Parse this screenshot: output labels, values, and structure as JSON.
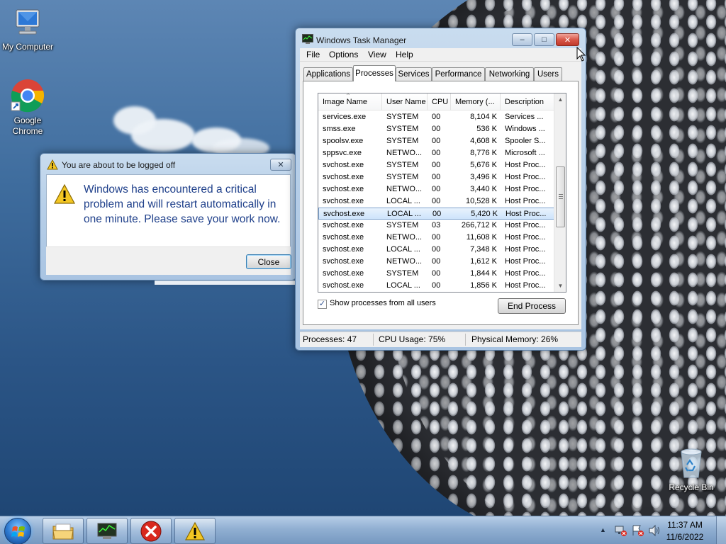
{
  "desktop": {
    "icons": [
      {
        "label": "My Computer",
        "icon": "computer-icon"
      },
      {
        "label": "Google Chrome",
        "icon": "chrome-icon"
      },
      {
        "label": "Recycle Bin",
        "icon": "recycle-bin-icon"
      }
    ]
  },
  "warning_dialog": {
    "title": "You are about to be logged off",
    "message": "Windows has encountered a critical problem and will restart automatically in one minute. Please save your work now.",
    "close_label": "Close",
    "close_glyph": "✕",
    "icon": "warning-icon"
  },
  "taskmgr": {
    "title": "Windows Task Manager",
    "caption": {
      "minimize": "–",
      "maximize": "□",
      "close": "✕"
    },
    "menu": [
      "File",
      "Options",
      "View",
      "Help"
    ],
    "tabs": [
      "Applications",
      "Processes",
      "Services",
      "Performance",
      "Networking",
      "Users"
    ],
    "active_tab": "Processes",
    "columns": [
      "Image Name",
      "User Name",
      "CPU",
      "Memory (...",
      "Description"
    ],
    "rows": [
      [
        "services.exe",
        "SYSTEM",
        "00",
        "8,104 K",
        "Services ..."
      ],
      [
        "smss.exe",
        "SYSTEM",
        "00",
        "536 K",
        "Windows ..."
      ],
      [
        "spoolsv.exe",
        "SYSTEM",
        "00",
        "4,608 K",
        "Spooler S..."
      ],
      [
        "sppsvc.exe",
        "NETWO...",
        "00",
        "8,776 K",
        "Microsoft ..."
      ],
      [
        "svchost.exe",
        "SYSTEM",
        "00",
        "5,676 K",
        "Host Proc..."
      ],
      [
        "svchost.exe",
        "SYSTEM",
        "00",
        "3,496 K",
        "Host Proc..."
      ],
      [
        "svchost.exe",
        "NETWO...",
        "00",
        "3,440 K",
        "Host Proc..."
      ],
      [
        "svchost.exe",
        "LOCAL ...",
        "00",
        "10,528 K",
        "Host Proc..."
      ],
      [
        "svchost.exe",
        "LOCAL ...",
        "00",
        "5,420 K",
        "Host Proc..."
      ],
      [
        "svchost.exe",
        "SYSTEM",
        "03",
        "266,712 K",
        "Host Proc..."
      ],
      [
        "svchost.exe",
        "NETWO...",
        "00",
        "11,608 K",
        "Host Proc..."
      ],
      [
        "svchost.exe",
        "LOCAL ...",
        "00",
        "7,348 K",
        "Host Proc..."
      ],
      [
        "svchost.exe",
        "NETWO...",
        "00",
        "1,612 K",
        "Host Proc..."
      ],
      [
        "svchost.exe",
        "SYSTEM",
        "00",
        "1,844 K",
        "Host Proc..."
      ],
      [
        "svchost.exe",
        "LOCAL ...",
        "00",
        "1,856 K",
        "Host Proc..."
      ]
    ],
    "selected_row": 8,
    "show_all_label": "Show processes from all users",
    "show_all_checked": "✓",
    "end_process_label": "End Process",
    "status": {
      "processes": "Processes: 47",
      "cpu": "CPU Usage: 75%",
      "memory": "Physical Memory: 26%"
    }
  },
  "taskbar": {
    "buttons": [
      "explorer-icon",
      "task-manager-icon",
      "error-icon",
      "warning-icon"
    ],
    "tray_arrow": "▲",
    "time": "11:37 AM",
    "date": "11/6/2022"
  }
}
